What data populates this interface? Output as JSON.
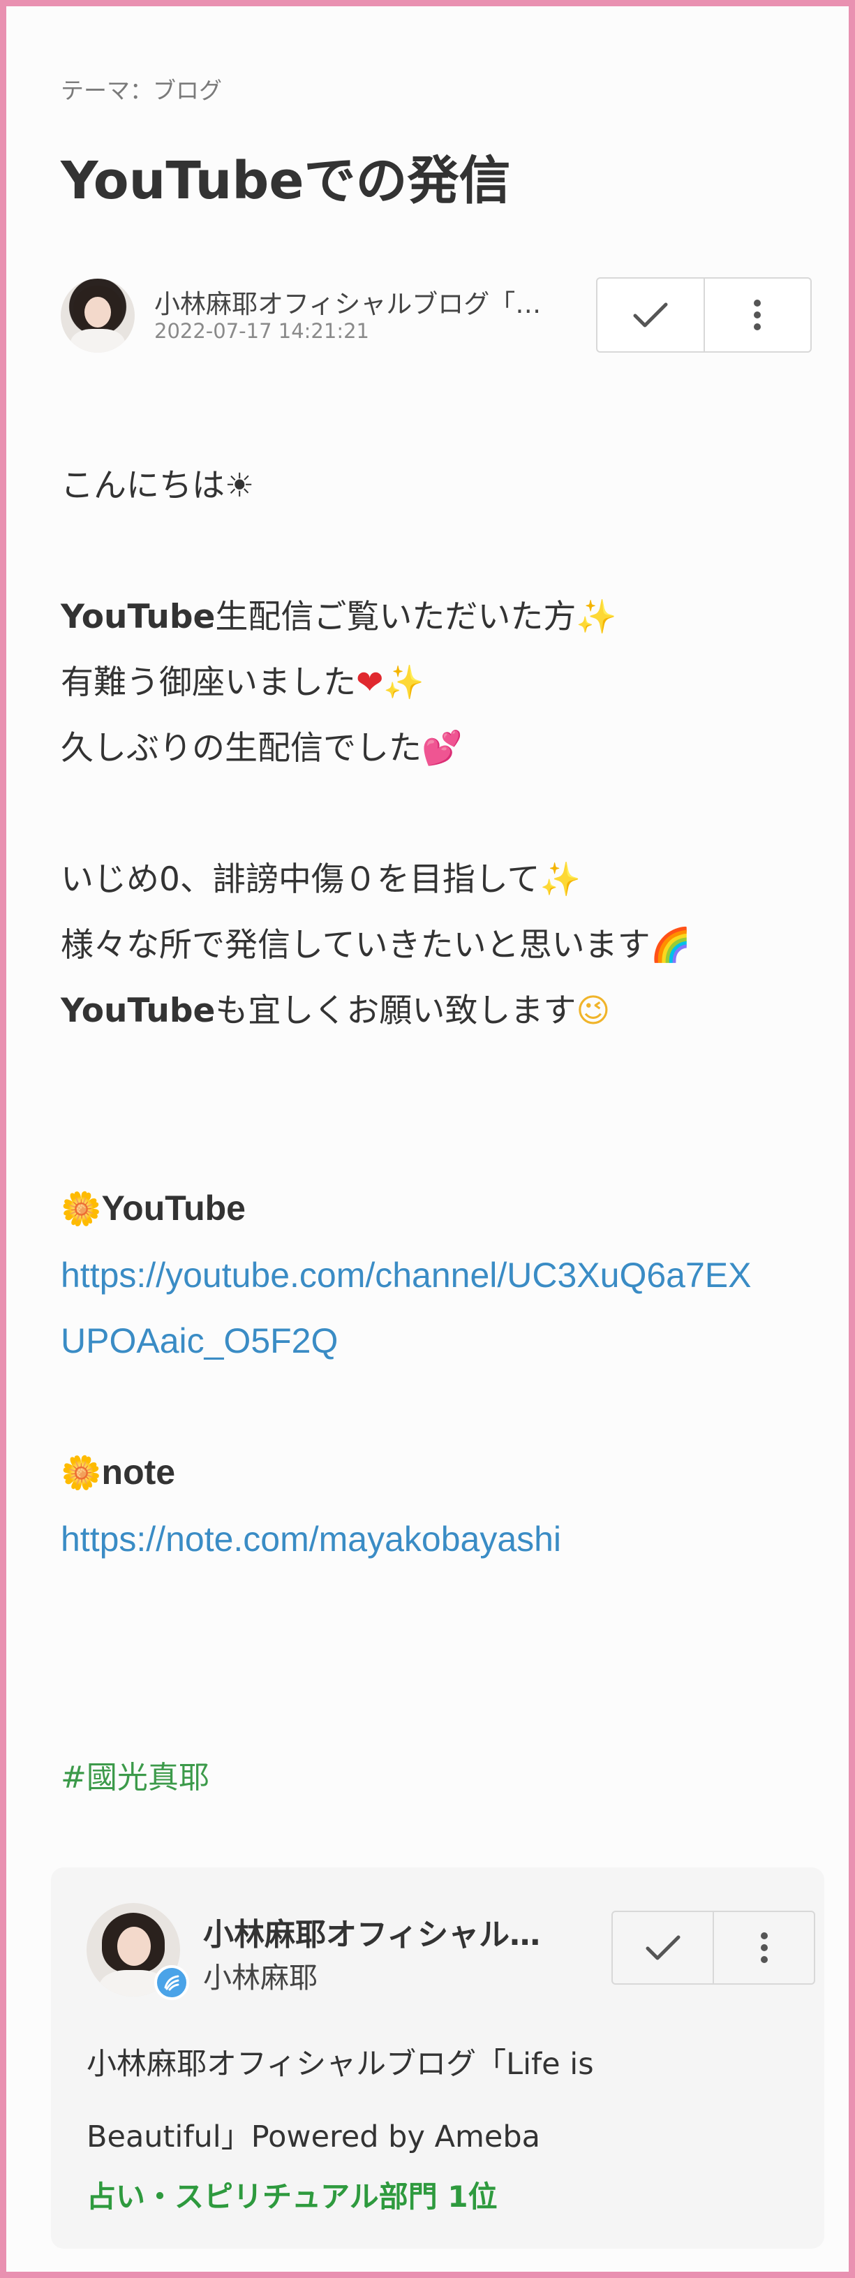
{
  "theme": "テーマ：ブログ",
  "title": "YouTubeでの発信",
  "author": {
    "name": "小林麻耶オフィシャルブログ「…",
    "datetime": "2022-07-17 14:21:21"
  },
  "body": {
    "greeting": "こんにちは",
    "line1_bold": "YouTube",
    "line1_rest": "生配信ご覧いただいた方",
    "line2": "有難う御座いました",
    "line3": "久しぶりの生配信でした",
    "line4": "いじめ0、誹謗中傷０を目指して",
    "line5": "様々な所で発信していきたいと思います",
    "line6_bold": "YouTube",
    "line6_rest": "も宜しくお願い致します"
  },
  "emoji": {
    "sun": "☀",
    "sparkle": "✨",
    "heart": "❤",
    "hearts": "💕",
    "rainbow": "🌈",
    "wink": "😉",
    "flower": "🌼"
  },
  "links": {
    "youtube_label": "YouTube",
    "youtube_url_line1": "https://youtube.com/channel/UC3XuQ6a7EX",
    "youtube_url_line2": "UPOAaic_O5F2Q",
    "note_label": "note",
    "note_url": "https://note.com/mayakobayashi"
  },
  "hashtag": "#國光真耶",
  "card": {
    "name": "小林麻耶オフィシャル…",
    "sub": "小林麻耶",
    "desc_line1": "小林麻耶オフィシャルブログ「Life is",
    "desc_line2": "Beautiful」Powered by Ameba",
    "rank": "占い・スピリチュアル部門 1位"
  },
  "icons": {
    "check": "check-icon",
    "more": "more-vertical-icon",
    "badge": "ameba-badge-icon"
  },
  "colors": {
    "frame": "#e991b1",
    "link": "#3a8cc5",
    "hashtag": "#3c9a4a",
    "rank": "#2e9a3e"
  }
}
